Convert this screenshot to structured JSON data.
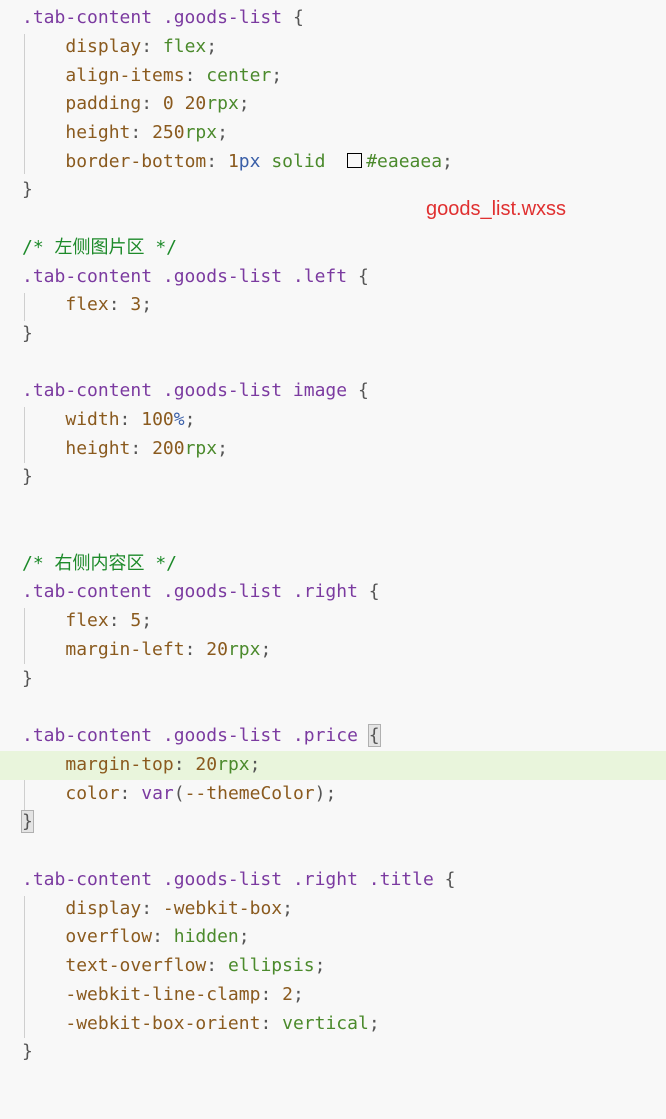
{
  "file_label": "goods_list.wxss",
  "highlight_color": "#e9f5dc",
  "code": {
    "b1_sel": ".tab-content .goods-list",
    "b1_p1": "display",
    "b1_v1": "flex",
    "b1_p2": "align-items",
    "b1_v2": "center",
    "b1_p3": "padding",
    "b1_v3a": "0",
    "b1_v3b": "20",
    "b1_v3bu": "rpx",
    "b1_p4": "height",
    "b1_v4": "250",
    "b1_v4u": "rpx",
    "b1_p5": "border-bottom",
    "b1_v5n": "1",
    "b1_v5u": "px",
    "b1_v5k": "solid",
    "b1_v5c": "#eaeaea",
    "c1": "/* 左侧图片区 */",
    "b2_sel": ".tab-content .goods-list .left",
    "b2_p1": "flex",
    "b2_v1": "3",
    "b3_sel": ".tab-content .goods-list image",
    "b3_p1": "width",
    "b3_v1": "100",
    "b3_v1u": "%",
    "b3_p2": "height",
    "b3_v2": "200",
    "b3_v2u": "rpx",
    "c2": "/* 右侧内容区 */",
    "b4_sel": ".tab-content .goods-list .right",
    "b4_p1": "flex",
    "b4_v1": "5",
    "b4_p2": "margin-left",
    "b4_v2": "20",
    "b4_v2u": "rpx",
    "b5_sel": ".tab-content .goods-list .price",
    "b5_p1": "margin-top",
    "b5_v1": "20",
    "b5_v1u": "rpx",
    "b5_p2": "color",
    "b5_v2f": "var",
    "b5_v2a": "--themeColor",
    "b6_sel": ".tab-content .goods-list .right .title",
    "b6_p1": "display",
    "b6_v1": "-webkit-box",
    "b6_p2": "overflow",
    "b6_v2": "hidden",
    "b6_p3": "text-overflow",
    "b6_v3": "ellipsis",
    "b6_p4": "-webkit-line-clamp",
    "b6_v4": "2",
    "b6_p5": "-webkit-box-orient",
    "b6_v5": "vertical"
  }
}
